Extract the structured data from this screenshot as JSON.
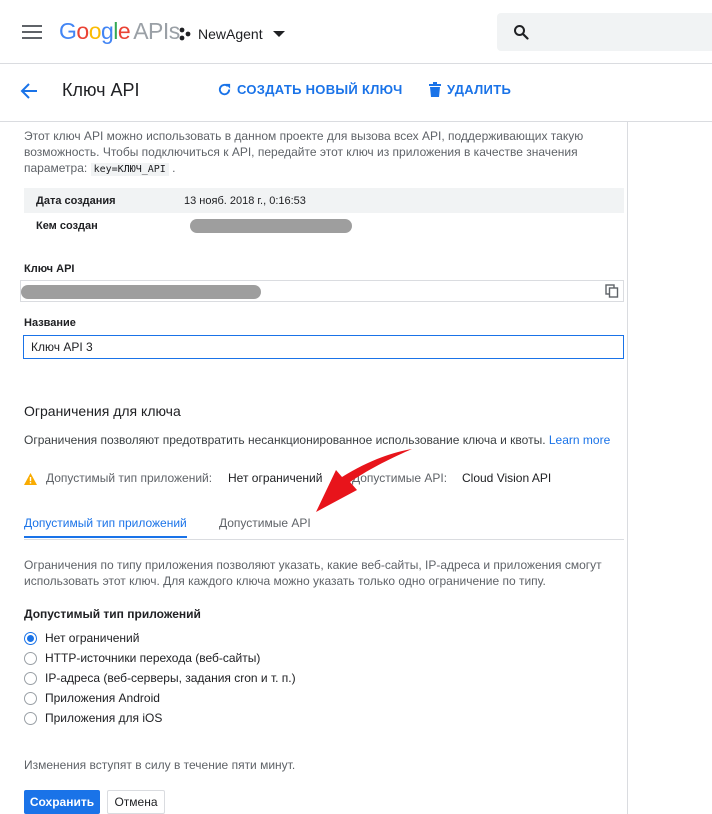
{
  "topbar": {
    "logo_letters": [
      "G",
      "o",
      "o",
      "g",
      "l",
      "e"
    ],
    "logo_suffix": "APIs",
    "project_name": "NewAgent"
  },
  "header": {
    "title": "Ключ API",
    "create_label": "СОЗДАТЬ НОВЫЙ КЛЮЧ",
    "delete_label": "УДАЛИТЬ"
  },
  "intro": {
    "text_before": "Этот ключ API можно использовать в данном проекте для вызова всех API, поддерживающих такую возможность. Чтобы подключиться к API, передайте этот ключ из приложения в качестве значения параметра:",
    "code": "key=КЛЮЧ_API",
    "text_after": "."
  },
  "meta": {
    "created_label": "Дата создания",
    "created_value": "13 нояб. 2018 г., 0:16:53",
    "creator_label": "Кем создан"
  },
  "key_field": {
    "label": "Ключ API"
  },
  "name_field": {
    "label": "Название",
    "value": "Ключ API 3"
  },
  "restrictions": {
    "title": "Ограничения для ключа",
    "description": "Ограничения позволяют предотвратить несанкционированное использование ключа и квоты.",
    "learn_more": "Learn more",
    "app_type_label": "Допустимый тип приложений:",
    "app_type_value": "Нет ограничений",
    "api_label": "Допустимые API:",
    "api_value": "Cloud Vision API"
  },
  "tabs": [
    {
      "label": "Допустимый тип приложений",
      "active": true
    },
    {
      "label": "Допустимые API",
      "active": false
    }
  ],
  "tab_content": {
    "description": "Ограничения по типу приложения позволяют указать, какие веб-сайты, IP-адреса и приложения смогут использовать этот ключ. Для каждого ключа можно указать только одно ограничение по типу.",
    "radio_title": "Допустимый тип приложений",
    "options": [
      {
        "label": "Нет ограничений",
        "checked": true
      },
      {
        "label": "HTTP-источники перехода (веб-сайты)",
        "checked": false
      },
      {
        "label": "IP-адреса (веб-серверы, задания cron и т. п.)",
        "checked": false
      },
      {
        "label": "Приложения Android",
        "checked": false
      },
      {
        "label": "Приложения для iOS",
        "checked": false
      }
    ]
  },
  "footer": {
    "note": "Изменения вступят в силу в течение пяти минут.",
    "save_label": "Сохранить",
    "cancel_label": "Отмена"
  },
  "colors": {
    "accent": "#1a73e8",
    "annotation_arrow": "#e8141b",
    "warning": "#f9ab00"
  }
}
